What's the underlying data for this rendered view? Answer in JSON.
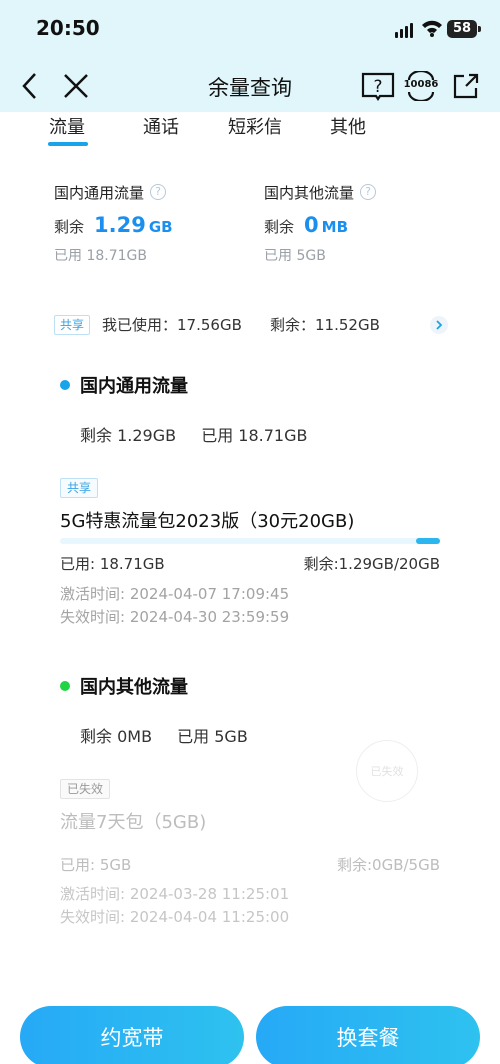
{
  "status_bar": {
    "time": "20:50",
    "battery": "58"
  },
  "navbar": {
    "title": "余量查询",
    "hotline_icon_text": "10086"
  },
  "tabs": [
    {
      "label": "流量",
      "active": true
    },
    {
      "label": "通话"
    },
    {
      "label": "短彩信"
    },
    {
      "label": "其他"
    }
  ],
  "summary": {
    "general": {
      "title": "国内通用流量",
      "remain_label": "剩余",
      "remain_value": "1.29",
      "remain_unit": "GB",
      "used_text": "已用 18.71GB"
    },
    "other": {
      "title": "国内其他流量",
      "remain_label": "剩余",
      "remain_value": "0",
      "remain_unit": "MB",
      "used_text": "已用 5GB"
    },
    "share": {
      "tag": "共享",
      "used_text": "我已使用：17.56GB",
      "remain_text": "剩余：11.52GB"
    }
  },
  "general_section": {
    "title": "国内通用流量",
    "remain_text": "剩余 1.29GB",
    "used_text": "已用 18.71GB",
    "package": {
      "tag": "共享",
      "name": "5G特惠流量包2023版（30元20GB)",
      "used_fraction": 0.9355,
      "used_text": "已用: 18.71GB",
      "remain_text": "剩余:1.29GB/20GB",
      "activated": "激活时间: 2024-04-07 17:09:45",
      "expires": "失效时间: 2024-04-30 23:59:59"
    }
  },
  "other_section": {
    "title": "国内其他流量",
    "remain_text": "剩余 0MB",
    "used_text": "已用 5GB",
    "package": {
      "tag": "已失效",
      "stamp": "已失效",
      "name": "流量7天包（5GB)",
      "used_text": "已用: 5GB",
      "remain_text": "剩余:0GB/5GB",
      "activated": "激活时间: 2024-03-28 11:25:01",
      "expires": "失效时间: 2024-04-04 11:25:00"
    }
  },
  "buttons": {
    "broadband": "约宽带",
    "change_plan": "换套餐"
  },
  "colors": {
    "accent": "#1a8ff0",
    "header_bg": "#e0f6fb",
    "general_dot": "#1aa3e8",
    "other_dot": "#22d444",
    "button": "#26a9f6"
  }
}
